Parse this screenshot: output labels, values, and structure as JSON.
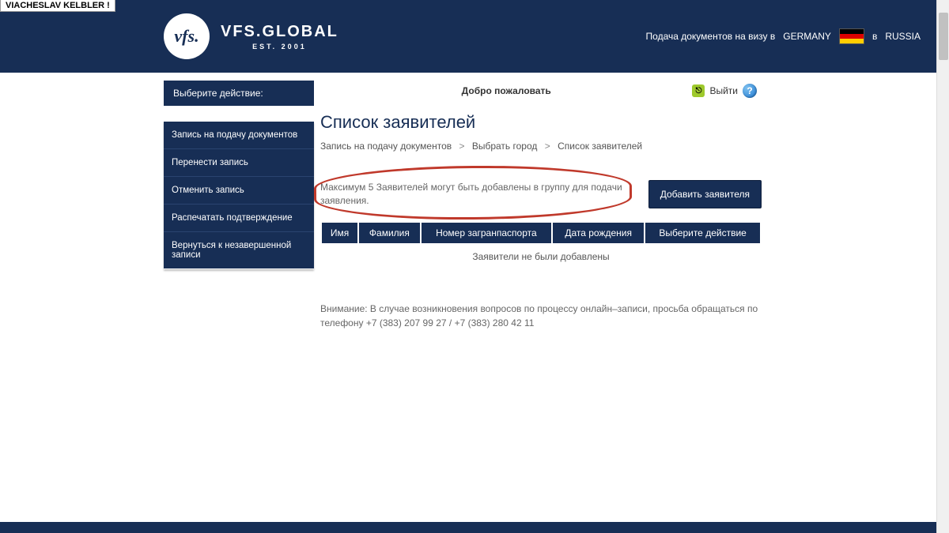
{
  "browser": {
    "tab_title": "VIACHESLAV KELBLER !"
  },
  "header": {
    "logo_script": "vfs.",
    "brand": "VFS.GLOBAL",
    "est": "EST. 2001",
    "tagline_prefix": "Подача документов на визу в ",
    "country_dest": "GERMANY",
    "tagline_suffix": " в ",
    "country_src": "RUSSIA"
  },
  "sidebar": {
    "header": "Выберите действие:",
    "items": [
      {
        "label": "Запись на подачу документов"
      },
      {
        "label": "Перенести запись"
      },
      {
        "label": "Отменить запись"
      },
      {
        "label": "Распечатать подтверждение"
      },
      {
        "label": "Вернуться к незавершенной записи"
      }
    ]
  },
  "topbar": {
    "welcome": "Добро пожаловать",
    "logout": "Выйти"
  },
  "page": {
    "title": "Список заявителей",
    "breadcrumb": {
      "a": "Запись на подачу документов",
      "b": "Выбрать город",
      "c": "Список заявителей"
    },
    "notice": "Максимум 5 Заявителей могут быть добавлены в группу для подачи заявления.",
    "add_button": "Добавить заявителя",
    "table": {
      "headers": [
        "Имя",
        "Фамилия",
        "Номер загранпаспорта",
        "Дата рождения",
        "Выберите действие"
      ],
      "empty": "Заявители не были добавлены"
    },
    "attention": "Внимание: В случае возникновения вопросов по процессу онлайн–записи, просьба обращаться по телефону +7 (383) 207 99 27 / +7 (383) 280 42 11"
  }
}
